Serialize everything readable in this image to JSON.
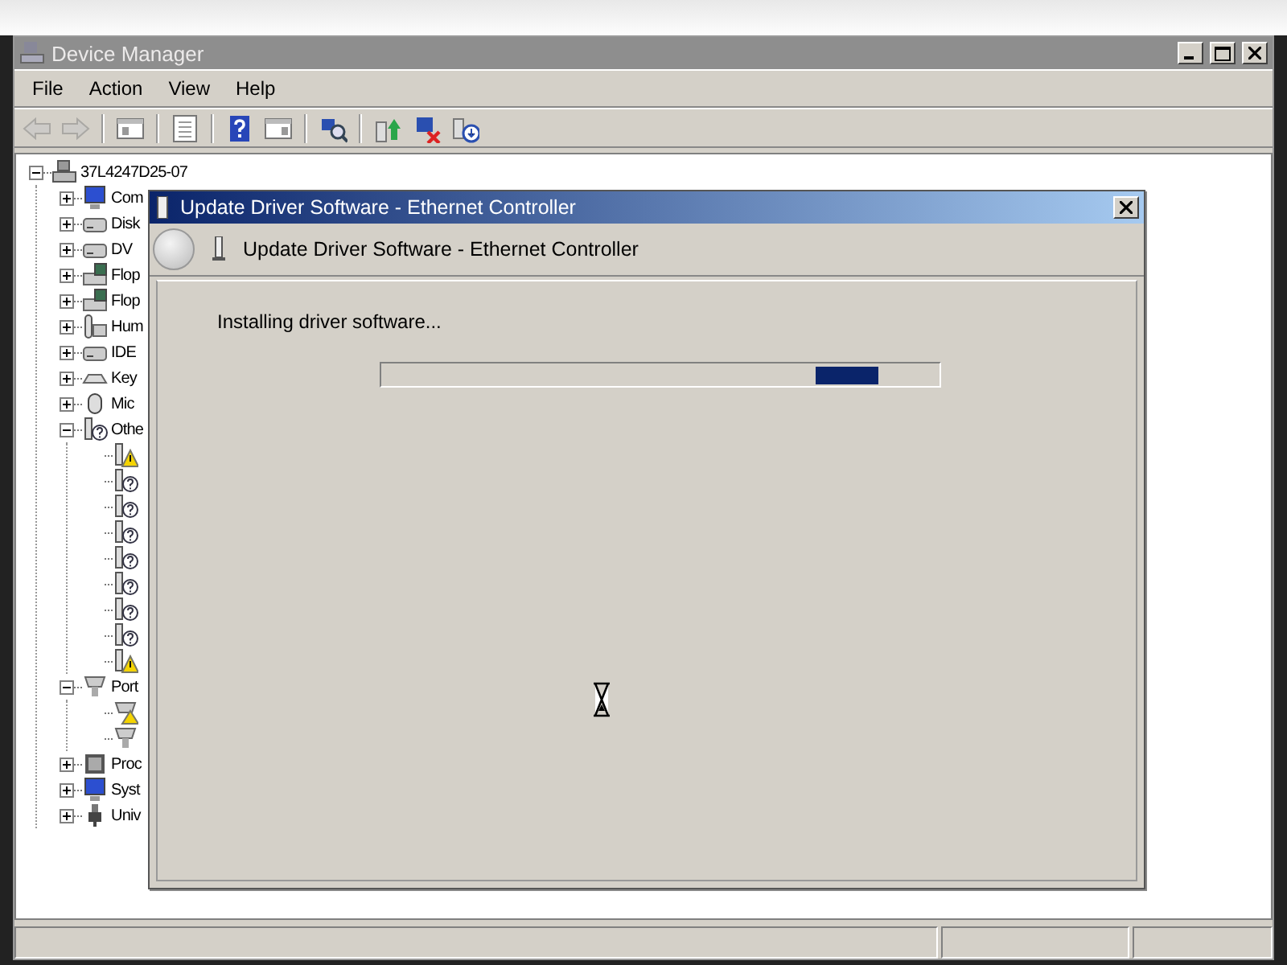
{
  "window": {
    "title": "Device Manager"
  },
  "menu": [
    {
      "label": "File"
    },
    {
      "label": "Action"
    },
    {
      "label": "View"
    },
    {
      "label": "Help"
    }
  ],
  "toolbar": [
    {
      "kind": "back",
      "disabled": true
    },
    {
      "kind": "forward",
      "disabled": true
    },
    {
      "kind": "separator"
    },
    {
      "kind": "tree",
      "disabled": false
    },
    {
      "kind": "separator"
    },
    {
      "kind": "properties",
      "disabled": false
    },
    {
      "kind": "separator"
    },
    {
      "kind": "help",
      "disabled": false
    },
    {
      "kind": "pane",
      "disabled": false
    },
    {
      "kind": "separator"
    },
    {
      "kind": "scan",
      "disabled": false
    },
    {
      "kind": "separator"
    },
    {
      "kind": "update",
      "disabled": false
    },
    {
      "kind": "uninstall",
      "disabled": false
    },
    {
      "kind": "disable",
      "disabled": false
    }
  ],
  "tree": {
    "label": "37L4247D25-07",
    "kind": "computer",
    "expanded": true,
    "children": [
      {
        "label": "Com",
        "kind": "monitor",
        "expanded": false
      },
      {
        "label": "Disk",
        "kind": "drive",
        "expanded": false
      },
      {
        "label": "DV",
        "kind": "drive",
        "expanded": false
      },
      {
        "label": "Flop",
        "kind": "floppy",
        "expanded": false
      },
      {
        "label": "Flop",
        "kind": "floppy",
        "expanded": false
      },
      {
        "label": "Hum",
        "kind": "hid",
        "expanded": false
      },
      {
        "label": "IDE",
        "kind": "drive",
        "expanded": false
      },
      {
        "label": "Key",
        "kind": "keyboard",
        "expanded": false
      },
      {
        "label": "Mic",
        "kind": "mouse",
        "expanded": false
      },
      {
        "label": "Othe",
        "kind": "unknown",
        "expanded": true,
        "children": [
          {
            "kind": "warning"
          },
          {
            "kind": "unknown"
          },
          {
            "kind": "unknown"
          },
          {
            "kind": "unknown"
          },
          {
            "kind": "unknown"
          },
          {
            "kind": "unknown"
          },
          {
            "kind": "unknown"
          },
          {
            "kind": "unknown"
          },
          {
            "kind": "warning"
          }
        ]
      },
      {
        "label": "Port",
        "kind": "port",
        "expanded": true,
        "children": [
          {
            "kind": "port-warning"
          },
          {
            "kind": "port"
          }
        ]
      },
      {
        "label": "Proc",
        "kind": "chip",
        "expanded": false
      },
      {
        "label": "Syst",
        "kind": "monitor",
        "expanded": false
      },
      {
        "label": "Univ",
        "kind": "usb",
        "expanded": false
      }
    ]
  },
  "dialog": {
    "title": "Update Driver Software - Ethernet Controller",
    "header": "Update Driver Software - Ethernet Controller",
    "message": "Installing driver software...",
    "progress": {
      "kind": "marquee"
    }
  }
}
